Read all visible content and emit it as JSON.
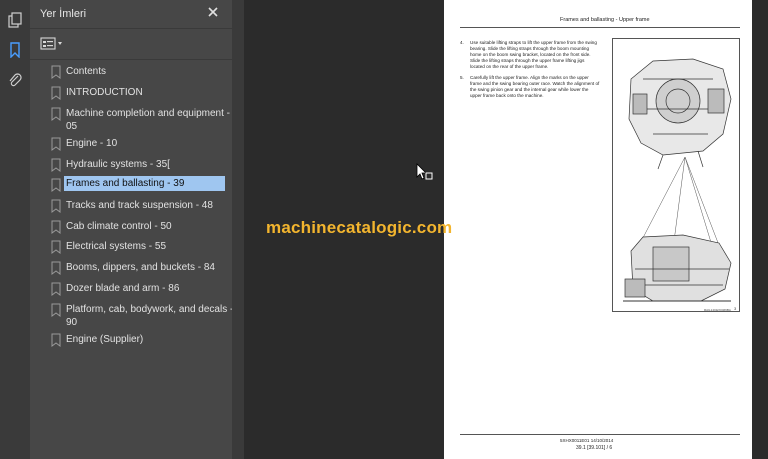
{
  "sidebar_panel": {
    "title": "Yer İmleri",
    "bookmarks": [
      {
        "label": "Contents"
      },
      {
        "label": "INTRODUCTION"
      },
      {
        "label": "Machine completion and equipment -",
        "label2": "05"
      },
      {
        "label": "Engine - 10"
      },
      {
        "label": "Hydraulic systems - 35["
      },
      {
        "label": "Frames and ballasting - 39",
        "selected": true
      },
      {
        "label": "Tracks and track suspension - 48"
      },
      {
        "label": "Cab climate control - 50"
      },
      {
        "label": "Electrical systems - 55"
      },
      {
        "label": "Booms, dippers, and buckets - 84"
      },
      {
        "label": "Dozer blade and arm - 86"
      },
      {
        "label": "Platform, cab, bodywork, and decals -",
        "label2": "90"
      },
      {
        "label": "Engine (Supplier)"
      }
    ]
  },
  "document_page": {
    "header": "Frames and ballasting - Upper frame",
    "steps": [
      {
        "num": "4.",
        "text": "Use suitable lifting straps to lift the upper frame from the swing bearing. Slide the lifting straps through the boom mounting home on the boom swing bracket, located on the front side. Slide the lifting straps through the upper frame lifting jigs located on the rear of the upper frame."
      },
      {
        "num": "5.",
        "text": "Carefully lift the upper frame. Align the marks on the upper frame and the swing bearing outer race. Watch the alignment of the swing pinion gear and the internal gear while lower the upper frame back onto the machine."
      }
    ],
    "figure_code": "RAIL14CEX0469BA",
    "figure_number": "3",
    "footer_line1": "5XHX0011E01 14/10/2014",
    "footer_line2": "39.1 [39.101] / 6"
  },
  "watermark": "machinecatalogic.com",
  "colors": {
    "selection": "#9fc6f0",
    "watermark": "#f3b52e",
    "panel": "#474747",
    "viewer_bg": "#2b2b2b"
  }
}
